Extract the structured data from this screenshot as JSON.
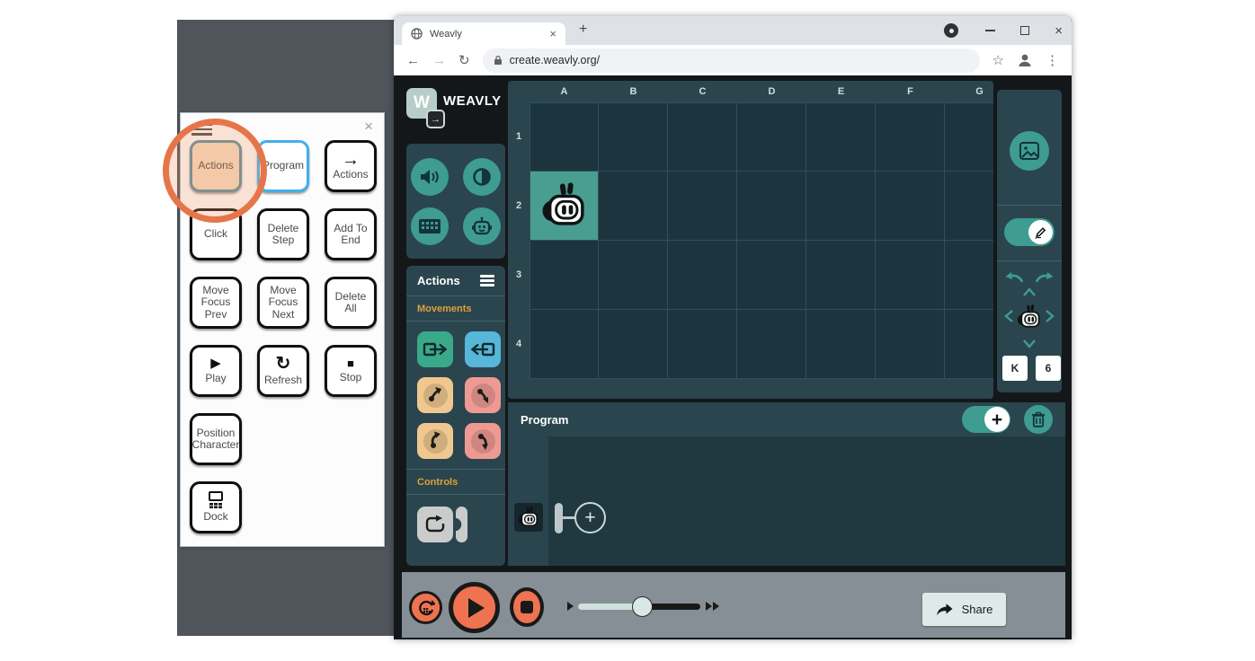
{
  "colors": {
    "accent_teal": "#3e9c90",
    "panel_teal": "#2a454e",
    "app_background": "#141719",
    "grid_cell": "#1c343d",
    "highlight_cell": "#4a9d91",
    "section_label_orange": "#dfa13c",
    "annotation_orange": "#e5764b",
    "play_orange": "#ef7350",
    "desktop_gray": "#4f555b",
    "bottom_bar_gray": "#878f96",
    "block_green": "#3aa98a",
    "block_blue": "#57b7d8",
    "block_tan": "#efc78f",
    "block_salmon": "#ee9a93",
    "block_gray": "#c9cccb"
  },
  "icons": {
    "arrow_right": "→",
    "play": "▶",
    "stop_square": "■",
    "refresh": "↻",
    "close": "×",
    "plus": "+",
    "star": "☆",
    "menu_dots": "⋮",
    "back": "←",
    "forward": "→",
    "reload": "↻"
  },
  "browser": {
    "tab_title": "Weavly",
    "url": "create.weavly.org/"
  },
  "panel": {
    "buttons": {
      "actions": "Actions",
      "program": "Program",
      "actions_arrow_label": "Actions",
      "click": "Click",
      "delete_step": "Delete Step",
      "add_to_end": "Add To End",
      "move_focus_prev": "Move Focus Prev",
      "move_focus_next": "Move Focus Next",
      "delete_all": "Delete All",
      "play": "Play",
      "refresh": "Refresh",
      "stop": "Stop",
      "position_character": "Position Character",
      "dock": "Dock"
    }
  },
  "app": {
    "logo_text": "WEAVLY",
    "logo_letter": "W",
    "actions_panel": {
      "title": "Actions",
      "movements_label": "Movements",
      "controls_label": "Controls"
    },
    "scene": {
      "columns": [
        "A",
        "B",
        "C",
        "D",
        "E",
        "F",
        "G"
      ],
      "rows": [
        "1",
        "2",
        "3",
        "4"
      ],
      "character_cell": "A2"
    },
    "right_panel": {
      "key_buttons": [
        "K",
        "6"
      ]
    },
    "program": {
      "title": "Program"
    },
    "bottom_bar": {
      "share_label": "Share"
    }
  }
}
